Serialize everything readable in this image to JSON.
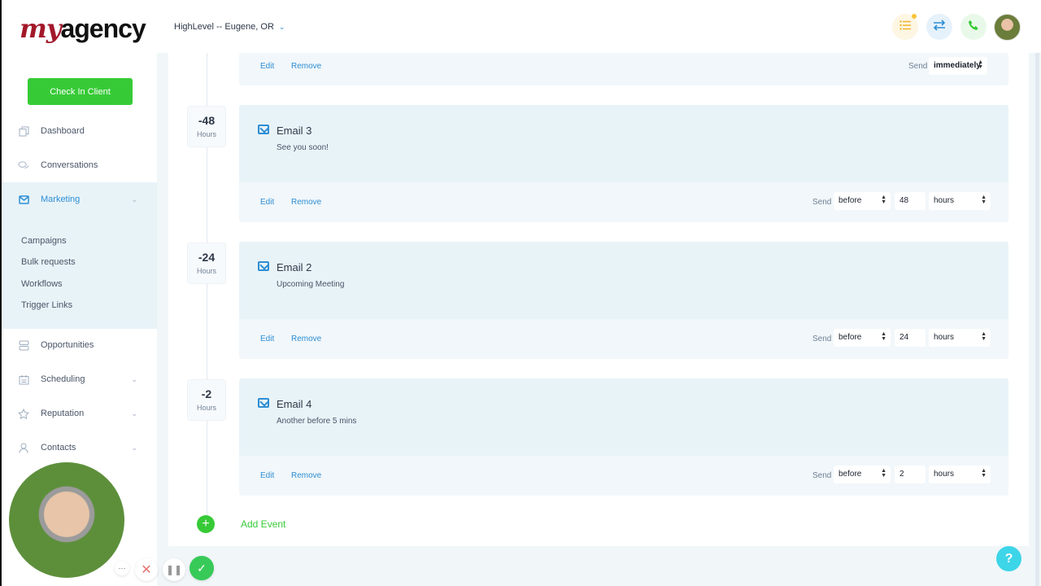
{
  "brand": {
    "logo_prefix": "my",
    "logo_suffix": "agency",
    "accent": "#2e8ed4",
    "success": "#37ca37"
  },
  "sidebar": {
    "check_in_label": "Check In Client",
    "items": [
      {
        "label": "Dashboard",
        "icon": "copy-icon"
      },
      {
        "label": "Conversations",
        "icon": "chat-icon"
      },
      {
        "label": "Marketing",
        "icon": "mail-icon",
        "active": true,
        "expanded": true
      },
      {
        "label": "Opportunities",
        "icon": "layers-icon"
      },
      {
        "label": "Scheduling",
        "icon": "calendar-icon"
      },
      {
        "label": "Reputation",
        "icon": "star-icon"
      },
      {
        "label": "Contacts",
        "icon": "user-icon"
      }
    ],
    "marketing_sub": [
      "Campaigns",
      "Bulk requests",
      "Workflows",
      "Trigger Links"
    ]
  },
  "header": {
    "location": "HighLevel -- Eugene, OR"
  },
  "timeline": {
    "top_partial": {
      "edit": "Edit",
      "remove": "Remove",
      "send_label": "Send",
      "timing": "immediately"
    },
    "events": [
      {
        "offset": "-48",
        "unit": "Hours",
        "title": "Email 3",
        "subtitle": "See you soon!",
        "edit": "Edit",
        "remove": "Remove",
        "send_label": "Send",
        "when": "before",
        "amount": "48",
        "period": "hours"
      },
      {
        "offset": "-24",
        "unit": "Hours",
        "title": "Email 2",
        "subtitle": "Upcoming Meeting",
        "edit": "Edit",
        "remove": "Remove",
        "send_label": "Send",
        "when": "before",
        "amount": "24",
        "period": "hours"
      },
      {
        "offset": "-2",
        "unit": "Hours",
        "title": "Email 4",
        "subtitle": "Another before 5 mins",
        "edit": "Edit",
        "remove": "Remove",
        "send_label": "Send",
        "when": "before",
        "amount": "2",
        "period": "hours"
      }
    ],
    "add_event_label": "Add Event"
  },
  "help_label": "?"
}
